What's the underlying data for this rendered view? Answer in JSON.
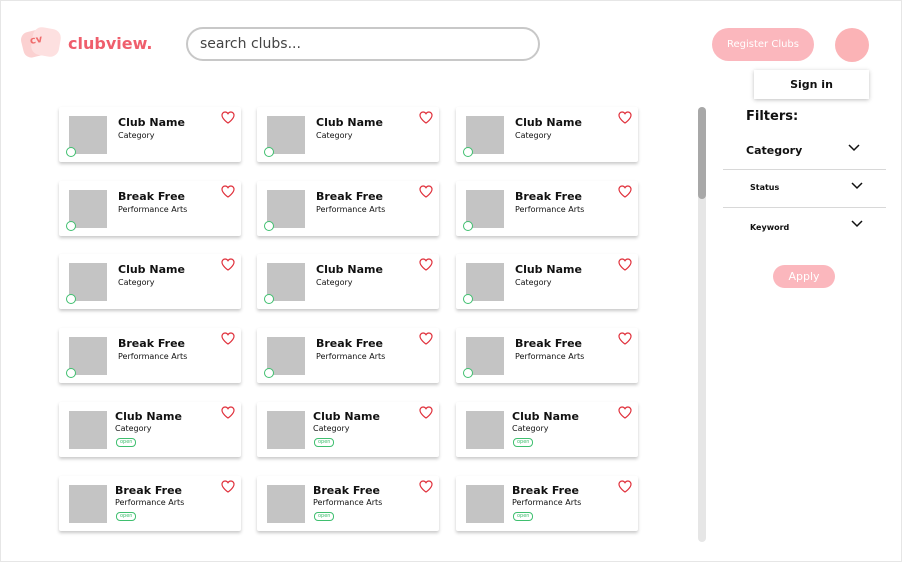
{
  "app": {
    "name": "clubview.",
    "logo_letters": "cv"
  },
  "search": {
    "placeholder": "search clubs..."
  },
  "header": {
    "register_label": "Register Clubs",
    "signin_label": "Sign in"
  },
  "filters": {
    "title": "Filters:",
    "items": [
      {
        "label": "Category"
      },
      {
        "label": "Status"
      },
      {
        "label": "Keyword"
      }
    ],
    "apply_label": "Apply"
  },
  "clubs": {
    "rows": [
      {
        "variant": "dot",
        "cards": [
          {
            "title": "Club Name",
            "subtitle": "Category"
          },
          {
            "title": "Club Name",
            "subtitle": "Category"
          },
          {
            "title": "Club Name",
            "subtitle": "Category"
          }
        ]
      },
      {
        "variant": "dot",
        "cards": [
          {
            "title": "Break Free",
            "subtitle": "Performance Arts"
          },
          {
            "title": "Break Free",
            "subtitle": "Performance Arts"
          },
          {
            "title": "Break Free",
            "subtitle": "Performance Arts"
          }
        ]
      },
      {
        "variant": "dot",
        "cards": [
          {
            "title": "Club Name",
            "subtitle": "Category"
          },
          {
            "title": "Club Name",
            "subtitle": "Category"
          },
          {
            "title": "Club Name",
            "subtitle": "Category"
          }
        ]
      },
      {
        "variant": "dot",
        "cards": [
          {
            "title": "Break Free",
            "subtitle": "Performance Arts"
          },
          {
            "title": "Break Free",
            "subtitle": "Performance Arts"
          },
          {
            "title": "Break Free",
            "subtitle": "Performance Arts"
          }
        ]
      },
      {
        "variant": "tag",
        "cards": [
          {
            "title": "Club Name",
            "subtitle": "Category",
            "tag": "open"
          },
          {
            "title": "Club Name",
            "subtitle": "Category",
            "tag": "open"
          },
          {
            "title": "Club Name",
            "subtitle": "Category",
            "tag": "open"
          }
        ]
      },
      {
        "variant": "tag",
        "cards": [
          {
            "title": "Break Free",
            "subtitle": "Performance Arts",
            "tag": "open"
          },
          {
            "title": "Break Free",
            "subtitle": "Performance Arts",
            "tag": "open"
          },
          {
            "title": "Break Free",
            "subtitle": "Performance Arts",
            "tag": "open"
          }
        ]
      }
    ]
  },
  "colors": {
    "brand": "#ef5e6c",
    "button_pink": "#fbb7bd",
    "status_green": "#3fbf6f",
    "heart_red": "#e0313c",
    "thumb_gray": "#c4c4c4"
  },
  "icons": {
    "favorite": "heart-outline-icon",
    "expand": "chevron-down-icon"
  }
}
